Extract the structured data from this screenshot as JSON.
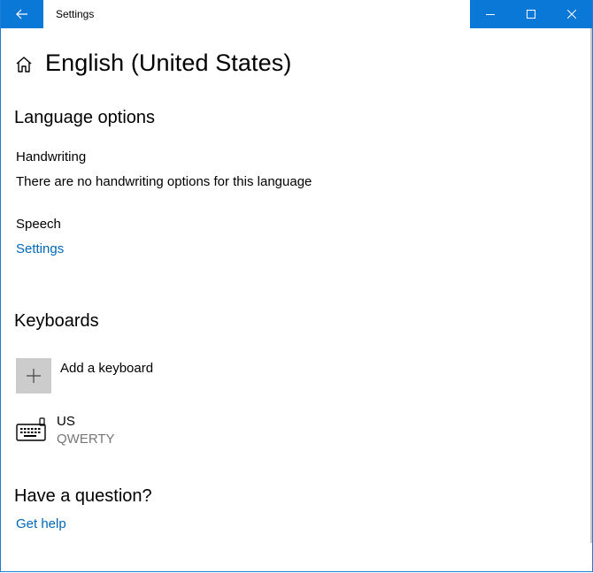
{
  "window": {
    "title": "Settings",
    "accent_color": "#0a78d7",
    "link_color": "#0067b8"
  },
  "header": {
    "title": "English (United States)"
  },
  "language_options": {
    "heading": "Language options",
    "handwriting_label": "Handwriting",
    "handwriting_text": "There are no handwriting options for this language",
    "speech_label": "Speech",
    "speech_link": "Settings"
  },
  "keyboards": {
    "heading": "Keyboards",
    "add_label": "Add a keyboard",
    "items": [
      {
        "name": "US",
        "layout": "QWERTY"
      }
    ]
  },
  "help": {
    "heading": "Have a question?",
    "link": "Get help"
  },
  "icons": {
    "back": "back-arrow-icon",
    "home": "home-icon",
    "minimize": "minimize-icon",
    "maximize": "maximize-icon",
    "close": "close-icon",
    "add": "plus-icon",
    "keyboard": "keyboard-icon"
  }
}
